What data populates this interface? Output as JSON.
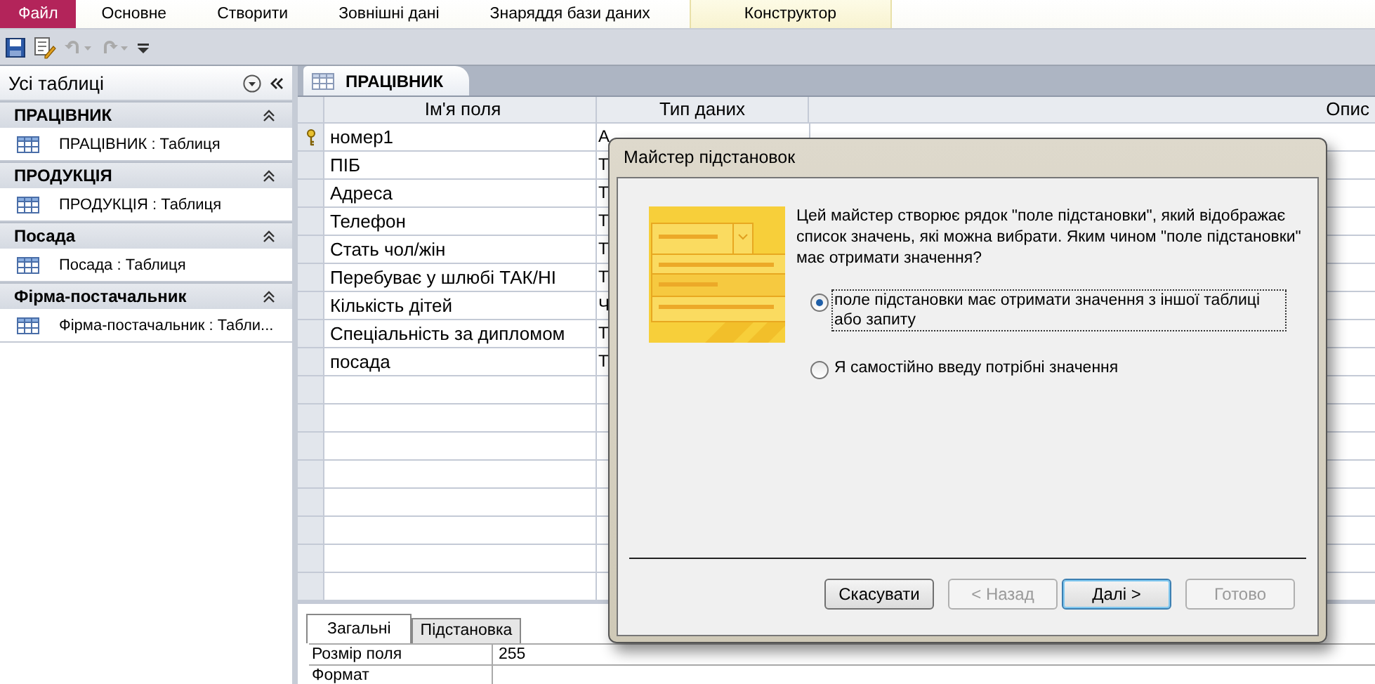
{
  "ribbon": {
    "tabs": [
      {
        "label": "Файл",
        "kind": "file",
        "selected": false
      },
      {
        "label": "Основне",
        "kind": "normal",
        "selected": false
      },
      {
        "label": "Створити",
        "kind": "normal",
        "selected": false
      },
      {
        "label": "Зовнішні дані",
        "kind": "normal",
        "selected": false
      },
      {
        "label": "Знаряддя бази даних",
        "kind": "normal",
        "selected": false
      },
      {
        "label": "Конструктор",
        "kind": "contextual",
        "selected": false
      }
    ]
  },
  "nav_pane": {
    "title": "Усі таблиці",
    "groups": [
      {
        "title": "ПРАЦІВНИК",
        "expanded": true,
        "items": [
          "ПРАЦІВНИК : Таблиця"
        ]
      },
      {
        "title": "ПРОДУКЦІЯ",
        "expanded": true,
        "items": [
          "ПРОДУКЦІЯ : Таблиця"
        ]
      },
      {
        "title": "Посада",
        "expanded": true,
        "items": [
          "Посада : Таблиця"
        ]
      },
      {
        "title": "Фірма-постачальник",
        "expanded": true,
        "items": [
          "Фірма-постачальник : Табли..."
        ]
      }
    ]
  },
  "document_tab": {
    "label": "ПРАЦІВНИК"
  },
  "design_grid": {
    "columns": [
      "Ім'я поля",
      "Тип даних",
      "Опис"
    ],
    "rows": [
      {
        "name": "номер1",
        "type": "А",
        "primary_key": true
      },
      {
        "name": "ПІБ",
        "type": "Т",
        "primary_key": false
      },
      {
        "name": "Адреса",
        "type": "Т",
        "primary_key": false
      },
      {
        "name": "Телефон",
        "type": "Т",
        "primary_key": false
      },
      {
        "name": "Стать чол/жін",
        "type": "Т",
        "primary_key": false
      },
      {
        "name": "Перебуває у шлюбі ТАК/НІ",
        "type": "Т",
        "primary_key": false
      },
      {
        "name": "Кількість дітей",
        "type": "Ч",
        "primary_key": false
      },
      {
        "name": "Спеціальність за дипломом",
        "type": "Т",
        "primary_key": false
      },
      {
        "name": "посада",
        "type": "Т",
        "primary_key": false
      }
    ]
  },
  "field_properties": {
    "tabs": [
      {
        "label": "Загальні",
        "selected": true
      },
      {
        "label": "Підстановка",
        "selected": false
      }
    ],
    "rows": [
      {
        "label": "Розмір поля",
        "value": "255"
      },
      {
        "label": "Формат"
      }
    ]
  },
  "dialog": {
    "title": "Майстер підстановок",
    "intro": "Цей майстер створює рядок \"поле підстановки\", який відображає список значень, які можна вибрати.  Яким чином \"поле підстановки\" має отримати значення?",
    "options": [
      {
        "label": "поле підстановки має отримати значення з іншої таблиці або запиту",
        "selected": true
      },
      {
        "label": "Я самостійно введу потрібні значення",
        "selected": false
      }
    ],
    "buttons": [
      {
        "label": "Скасувати",
        "disabled": false,
        "default": false
      },
      {
        "label": "< Назад",
        "disabled": true,
        "default": false
      },
      {
        "label": "Далі >",
        "disabled": false,
        "default": true
      },
      {
        "label": "Готово",
        "disabled": true,
        "default": false
      }
    ]
  }
}
